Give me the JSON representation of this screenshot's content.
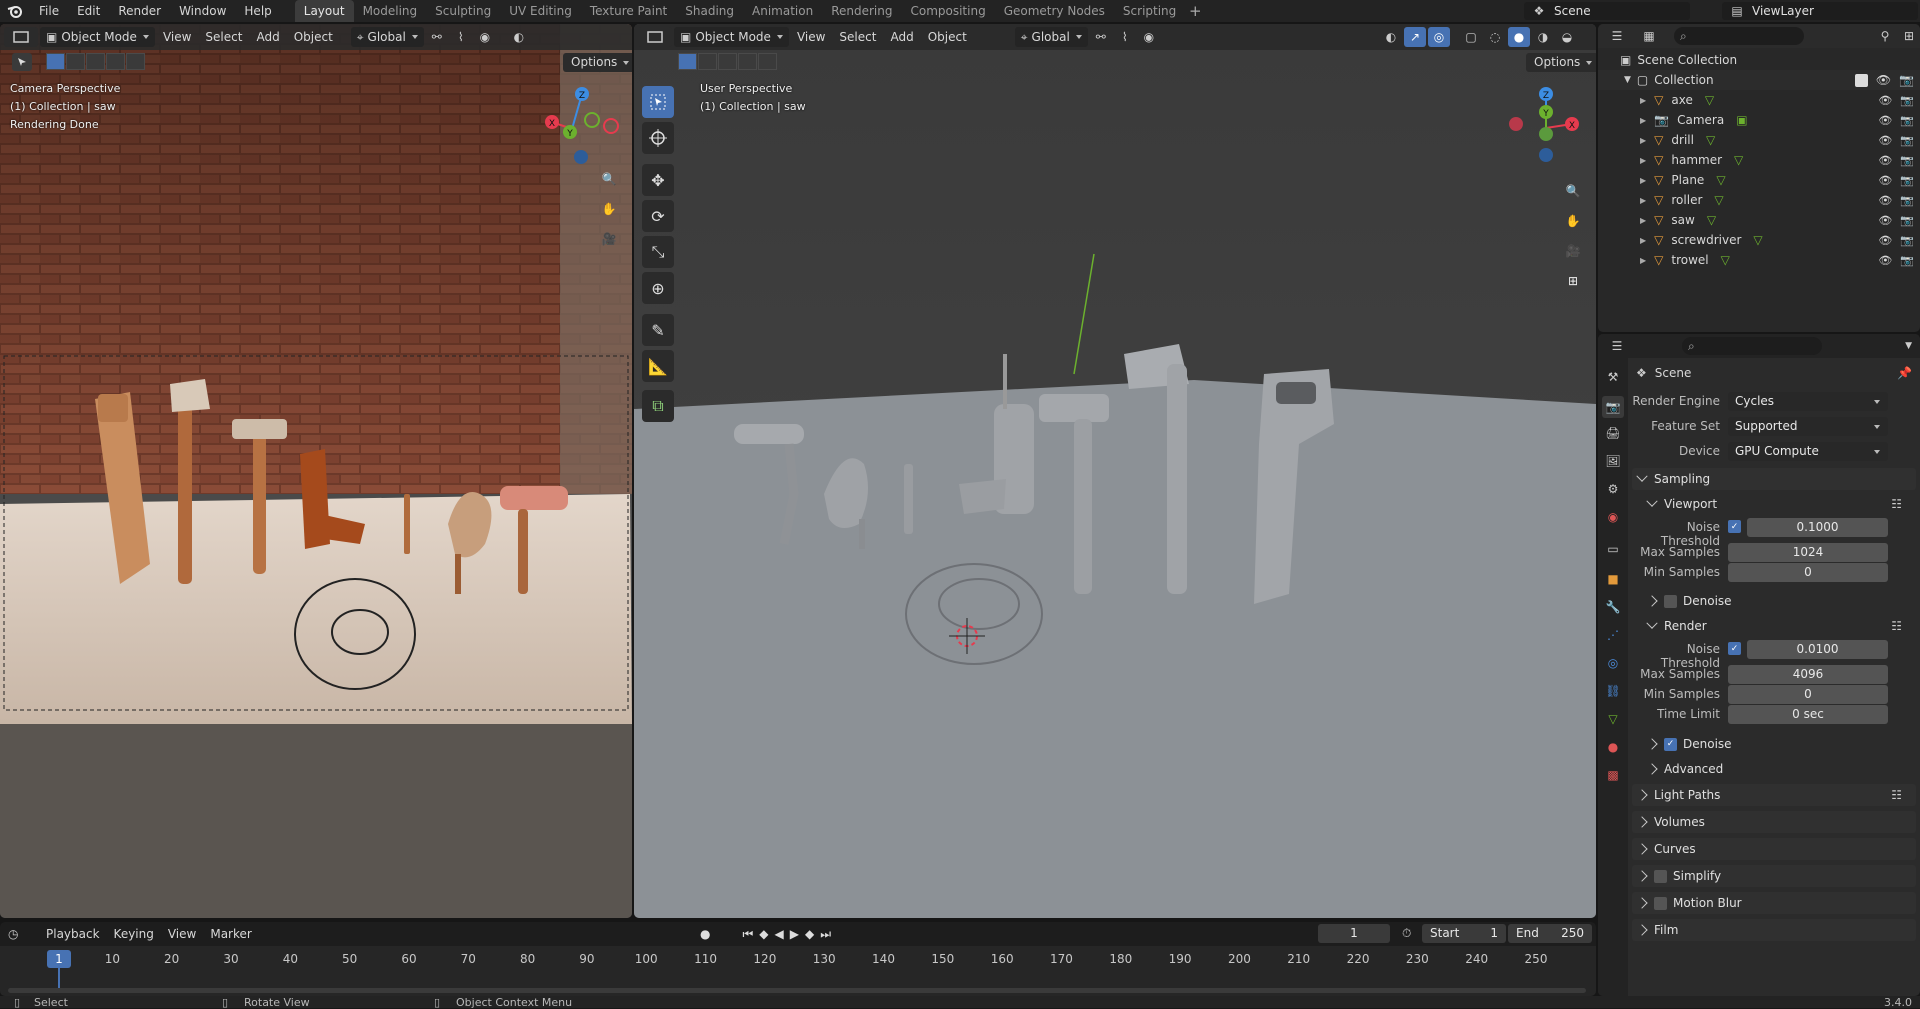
{
  "topbar": {
    "menu": [
      "File",
      "Edit",
      "Render",
      "Window",
      "Help"
    ],
    "tabs": [
      "Layout",
      "Modeling",
      "Sculpting",
      "UV Editing",
      "Texture Paint",
      "Shading",
      "Animation",
      "Rendering",
      "Compositing",
      "Geometry Nodes",
      "Scripting"
    ],
    "active_tab": "Layout",
    "scene_name": "Scene",
    "view_layer": "ViewLayer"
  },
  "left_viewport": {
    "mode": "Object Mode",
    "menus": [
      "View",
      "Select",
      "Add",
      "Object"
    ],
    "transform": "Global",
    "options_label": "Options",
    "overlay_lines": [
      "Camera Perspective",
      "(1) Collection | saw",
      "Rendering Done"
    ]
  },
  "right_viewport": {
    "mode": "Object Mode",
    "menus": [
      "View",
      "Select",
      "Add",
      "Object"
    ],
    "transform": "Global",
    "options_label": "Options",
    "overlay_lines": [
      "User Perspective",
      "(1) Collection | saw"
    ]
  },
  "gizmo": {
    "x": "X",
    "y": "Y",
    "z": "Z"
  },
  "outliner": {
    "root": "Scene Collection",
    "collection": "Collection",
    "items": [
      "axe",
      "Camera",
      "drill",
      "hammer",
      "Plane",
      "roller",
      "saw",
      "screwdriver",
      "trowel"
    ]
  },
  "properties": {
    "context": "Scene",
    "render_engine_label": "Render Engine",
    "render_engine": "Cycles",
    "feature_set_label": "Feature Set",
    "feature_set": "Supported",
    "device_label": "Device",
    "device": "GPU Compute",
    "sampling": "Sampling",
    "viewport": "Viewport",
    "noise_threshold_label": "Noise Threshold",
    "viewport_noise": "0.1000",
    "max_samples_label": "Max Samples",
    "viewport_max": "1024",
    "min_samples_label": "Min Samples",
    "viewport_min": "0",
    "denoise_label": "Denoise",
    "render": "Render",
    "render_noise": "0.0100",
    "render_max": "4096",
    "render_min": "0",
    "time_limit_label": "Time Limit",
    "time_limit": "0 sec",
    "advanced": "Advanced",
    "sections": [
      "Light Paths",
      "Volumes",
      "Curves",
      "Simplify",
      "Motion Blur",
      "Film"
    ]
  },
  "timeline": {
    "menus": [
      "Playback",
      "Keying",
      "View",
      "Marker"
    ],
    "current_frame": "1",
    "start_label": "Start",
    "start": "1",
    "end_label": "End",
    "end": "250",
    "ticks": [
      "10",
      "20",
      "30",
      "40",
      "50",
      "60",
      "70",
      "80",
      "90",
      "100",
      "110",
      "120",
      "130",
      "140",
      "150",
      "160",
      "170",
      "180",
      "190",
      "200",
      "210",
      "220",
      "230",
      "240",
      "250"
    ]
  },
  "statusbar": {
    "select": "Select",
    "rotate": "Rotate View",
    "context": "Object Context Menu",
    "version": "3.4.0"
  },
  "colors": {
    "accent": "#4772b3",
    "x_axis": "#e63b4e",
    "y_axis": "#6cb12e",
    "z_axis": "#3c8de3"
  }
}
